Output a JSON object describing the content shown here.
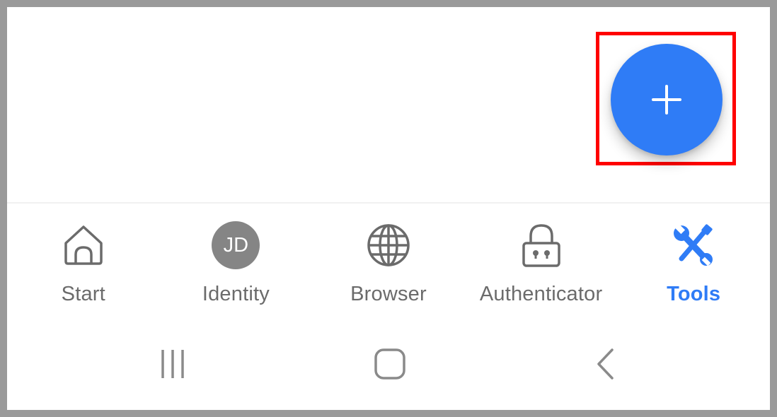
{
  "fab": {
    "icon": "plus-icon",
    "color": "#2f7cf6"
  },
  "highlight": {
    "color": "#ff0000"
  },
  "tabs": [
    {
      "id": "start",
      "label": "Start",
      "icon": "home-icon",
      "active": false
    },
    {
      "id": "identity",
      "label": "Identity",
      "icon": "avatar",
      "avatar_initials": "JD",
      "active": false
    },
    {
      "id": "browser",
      "label": "Browser",
      "icon": "globe-icon",
      "active": false
    },
    {
      "id": "authenticator",
      "label": "Authenticator",
      "icon": "lock-icon",
      "active": false
    },
    {
      "id": "tools",
      "label": "Tools",
      "icon": "tools-icon",
      "active": true
    }
  ],
  "colors": {
    "active": "#2f7cf6",
    "inactive": "#6b6b6b"
  },
  "system_nav": [
    {
      "name": "recents-button",
      "icon": "recents-icon"
    },
    {
      "name": "home-button",
      "icon": "home-square-icon"
    },
    {
      "name": "back-button",
      "icon": "back-chevron-icon"
    }
  ]
}
